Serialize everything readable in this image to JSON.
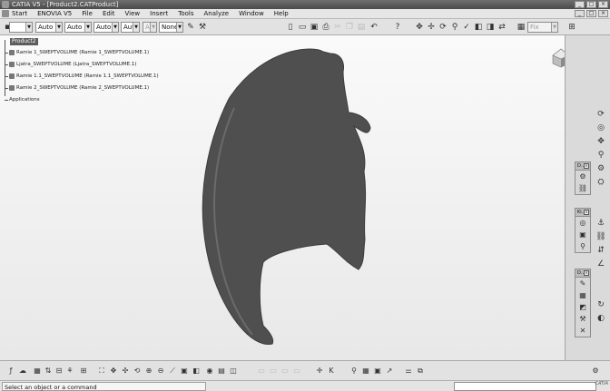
{
  "window": {
    "title": "CATIA V5 - [Product2.CATProduct]",
    "min": "_",
    "max": "□",
    "close": "×"
  },
  "menu": [
    {
      "label": "Start",
      "name": "menu-start"
    },
    {
      "label": "ENOVIA V5",
      "name": "menu-enovia"
    },
    {
      "label": "File",
      "name": "menu-file"
    },
    {
      "label": "Edit",
      "name": "menu-edit"
    },
    {
      "label": "View",
      "name": "menu-view"
    },
    {
      "label": "Insert",
      "name": "menu-insert"
    },
    {
      "label": "Tools",
      "name": "menu-tools"
    },
    {
      "label": "Analyze",
      "name": "menu-analyze"
    },
    {
      "label": "Window",
      "name": "menu-window"
    },
    {
      "label": "Help",
      "name": "menu-help"
    }
  ],
  "toolbar": {
    "combo_blank": "",
    "combo_auto_1": "Auto",
    "combo_auto_2": "Auto",
    "combo_auto_3": "Auto",
    "combo_aut_4": "Aut",
    "combo_aut_5": "Aut",
    "combo_none": "None",
    "combo_fix": "Fix"
  },
  "tree": {
    "root": "Product2",
    "items": [
      "Ramie 1_SWEPTVOLUME (Ramie 1_SWEPTVOLUME.1)",
      "Ljatra_SWEPTVOLUME (Ljatra_SWEPTVOLUME.1)",
      "Ramie 1.1_SWEPTVOLUME (Ramie 1.1_SWEPTVOLUME.1)",
      "Ramie 2_SWEPTVOLUME (Ramie 2_SWEPTVOLUME.1)"
    ],
    "applications": "Applications"
  },
  "palettes": {
    "p1": "D...",
    "p2": "Ki...",
    "p3": "D..."
  },
  "status": {
    "prompt": "Select an object or a command",
    "logo": "CATIA"
  },
  "colors": {
    "shape": "#505050",
    "background": "#f2f2f2"
  }
}
